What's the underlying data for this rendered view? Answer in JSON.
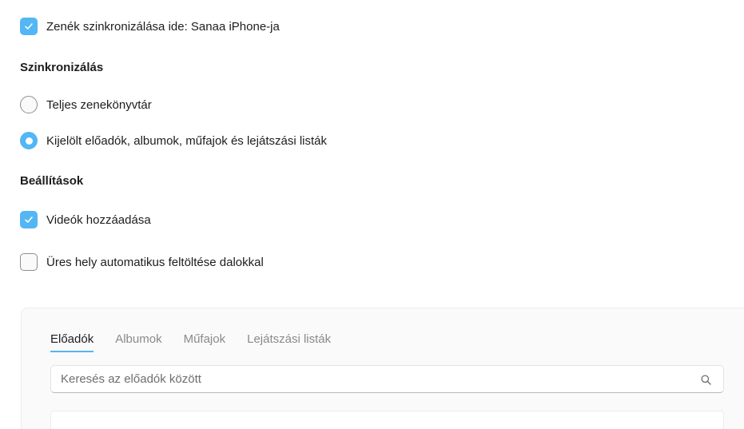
{
  "sync_toggle": {
    "label": "Zenék szinkronizálása ide: Sanaa iPhone-ja",
    "checked": true
  },
  "sync_section": {
    "heading": "Szinkronizálás",
    "options": [
      {
        "label": "Teljes zenekönyvtár",
        "selected": false
      },
      {
        "label": "Kijelölt előadók, albumok, műfajok és lejátszási listák",
        "selected": true
      }
    ]
  },
  "settings_section": {
    "heading": "Beállítások",
    "options": [
      {
        "label": "Videók hozzáadása",
        "checked": true
      },
      {
        "label": "Üres hely automatikus feltöltése dalokkal",
        "checked": false
      }
    ]
  },
  "browser": {
    "tabs": [
      {
        "label": "Előadók",
        "active": true
      },
      {
        "label": "Albumok",
        "active": false
      },
      {
        "label": "Műfajok",
        "active": false
      },
      {
        "label": "Lejátszási listák",
        "active": false
      }
    ],
    "search": {
      "placeholder": "Keresés az előadók között",
      "value": "",
      "icon": "search-icon"
    }
  },
  "colors": {
    "accent": "#53b6f5",
    "text": "#1d1d1f",
    "secondary_text": "#8a8a8e"
  }
}
